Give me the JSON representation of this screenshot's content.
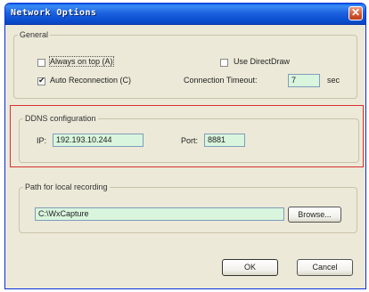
{
  "window": {
    "title": "Network Options",
    "close_glyph": "✕"
  },
  "general": {
    "legend": "General",
    "always_on_top": {
      "label": "Always on top (A)",
      "checked": false
    },
    "use_directdraw": {
      "label": "Use DirectDraw",
      "checked": false
    },
    "auto_reconnection": {
      "label": "Auto Reconnection (C)",
      "checked": true
    },
    "timeout": {
      "label": "Connection Timeout:",
      "value": "7",
      "unit": "sec"
    }
  },
  "ddns": {
    "legend": "DDNS configuration",
    "ip_label": "IP:",
    "ip_value": "192.193.10.244",
    "port_label": "Port:",
    "port_value": "8881"
  },
  "recording": {
    "legend": "Path for local recording",
    "path_value": "C:\\WxCapture",
    "browse_label": "Browse..."
  },
  "buttons": {
    "ok": "OK",
    "cancel": "Cancel"
  },
  "colors": {
    "highlight": "#d83030",
    "field_bg": "#d9f5dd",
    "title_bar": "#0b4fd1"
  }
}
